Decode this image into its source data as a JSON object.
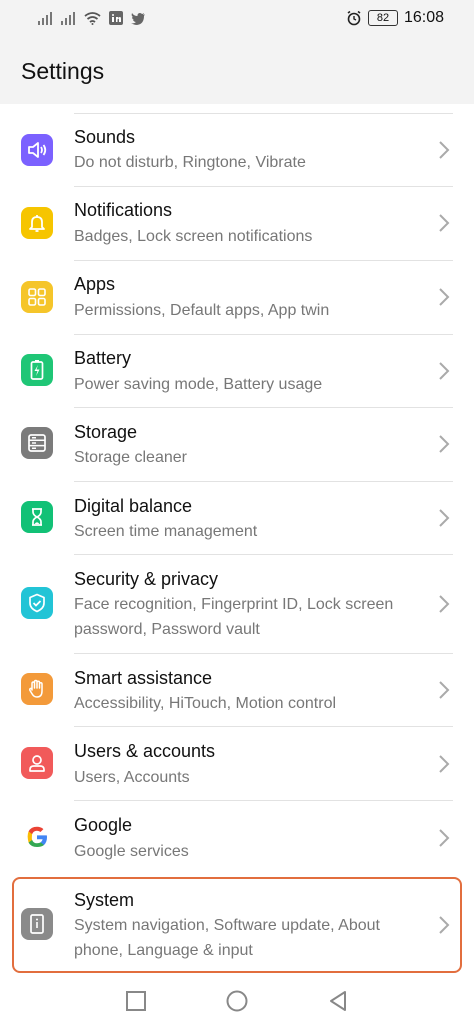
{
  "status_bar": {
    "battery_level": "82",
    "time": "16:08",
    "icons": [
      "signal-icon",
      "signal-icon",
      "wifi-icon",
      "linkedin-icon",
      "twitter-icon",
      "alarm-icon",
      "battery-icon"
    ]
  },
  "header": {
    "title": "Settings"
  },
  "items": [
    {
      "title": "Sounds",
      "subtitle": "Do not disturb, Ringtone, Vibrate",
      "icon": "sound-icon",
      "color": "#7b61ff"
    },
    {
      "title": "Notifications",
      "subtitle": "Badges, Lock screen notifications",
      "icon": "bell-icon",
      "color": "#f6c500"
    },
    {
      "title": "Apps",
      "subtitle": "Permissions, Default apps, App twin",
      "icon": "apps-grid-icon",
      "color": "#f5c52a"
    },
    {
      "title": "Battery",
      "subtitle": "Power saving mode, Battery usage",
      "icon": "battery-icon",
      "color": "#1fc676"
    },
    {
      "title": "Storage",
      "subtitle": "Storage cleaner",
      "icon": "storage-icon",
      "color": "#7b7b7b"
    },
    {
      "title": "Digital balance",
      "subtitle": "Screen time management",
      "icon": "hourglass-icon",
      "color": "#12c176"
    },
    {
      "title": "Security & privacy",
      "subtitle": "Face recognition, Fingerprint ID, Lock screen password, Password vault",
      "icon": "shield-icon",
      "color": "#22c4d6"
    },
    {
      "title": "Smart assistance",
      "subtitle": "Accessibility, HiTouch, Motion control",
      "icon": "hand-icon",
      "color": "#f39a3a"
    },
    {
      "title": "Users & accounts",
      "subtitle": "Users, Accounts",
      "icon": "user-icon",
      "color": "#f15a5a"
    },
    {
      "title": "Google",
      "subtitle": "Google services",
      "icon": "google-icon",
      "color": "#ffffff"
    },
    {
      "title": "System",
      "subtitle": "System navigation, Software update, About phone, Language & input",
      "icon": "phone-info-icon",
      "color": "#8a8a8a"
    }
  ],
  "highlight_color": "#e26e3e",
  "navigation": {
    "icons": [
      "recent-apps-icon",
      "home-icon",
      "back-icon"
    ]
  }
}
